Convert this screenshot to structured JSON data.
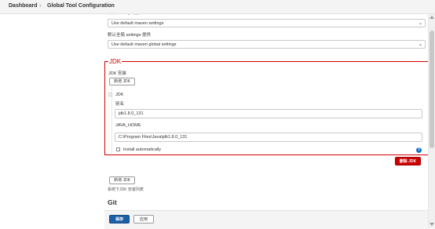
{
  "breadcrumb": {
    "home": "Dashboard",
    "separator": "›",
    "current": "Global Tool Configuration"
  },
  "maven": {
    "settings_label": "默认 settings 提供",
    "settings_value": "Use default maven settings",
    "global_settings_label": "默认全局 settings 提供",
    "global_settings_value": "Use default maven global settings"
  },
  "jdk": {
    "section_title": "JDK",
    "installations_label": "JDK 安装",
    "add_button_top": "新增 JDK",
    "item_title": "JDK",
    "name_label": "别名",
    "name_value": "jdk1.8.0_131",
    "home_label": "JAVA_HOME",
    "home_value": "C:\\Program Files\\Java\\jdk1.8.0_131",
    "install_auto_label": "Install automatically",
    "help_icon": "?",
    "delete_button": "删除 JDK",
    "add_button_bottom": "新增 JDK",
    "list_note": "系统下JDK 安装列表"
  },
  "git": {
    "section_title": "Git"
  },
  "footer": {
    "save_button": "保存",
    "apply_button": "应用"
  },
  "colors": {
    "highlight_border": "#d60000",
    "danger": "#cc0000",
    "primary": "#1b5fa8",
    "help": "#1b6ec2"
  }
}
